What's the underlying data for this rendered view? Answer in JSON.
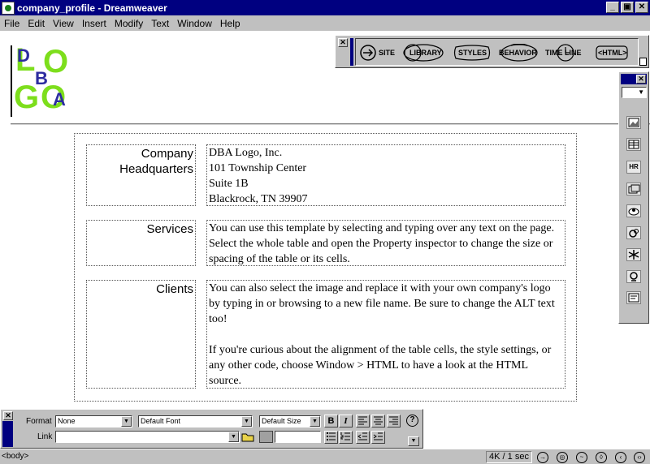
{
  "window": {
    "title": "company_profile - Dreamweaver",
    "minimize": "_",
    "restore": "▣",
    "close": "✕"
  },
  "menu": [
    "File",
    "Edit",
    "View",
    "Insert",
    "Modify",
    "Text",
    "Window",
    "Help"
  ],
  "logo": {
    "letters": [
      "L",
      "O",
      "G",
      "O"
    ],
    "overlay": [
      "D",
      "B",
      "A"
    ]
  },
  "rows": [
    {
      "label_line1": "Company",
      "label_line2": "Headquarters",
      "lines": [
        "DBA Logo, Inc.",
        "101 Township Center",
        "Suite 1B",
        "Blackrock, TN 39907"
      ]
    },
    {
      "label": "Services",
      "text": "You can use this template by selecting and typing over any text on the page. Select the whole table and open the Property inspector to change the size or spacing of the table or its cells."
    },
    {
      "label": "Clients",
      "para1": "You can also select the image and replace it with your own company's logo by typing in or browsing to a new file name. Be sure to change the ALT text too!",
      "para2": "If you're curious about the alignment of the table cells, the style settings, or any other code, choose Window > HTML to have a look at the HTML source."
    }
  ],
  "launcher": {
    "buttons": [
      "SITE",
      "LIBRARY",
      "STYLES",
      "BEHAVIOR",
      "TIME LINE",
      "<HTML>"
    ]
  },
  "objects": {
    "buttons": [
      "image-icon",
      "table-icon",
      "hr-icon",
      "layer-icon",
      "plugin-icon",
      "applet-icon",
      "activex-icon",
      "java-icon",
      "form-icon"
    ],
    "hr_label": "HR"
  },
  "properties": {
    "format_label": "Format",
    "format_value": "None",
    "font_value": "Default Font",
    "size_value": "Default Size",
    "link_label": "Link",
    "link_value": "",
    "bold": "B",
    "italic": "I",
    "help": "?"
  },
  "status": {
    "tag": "<body>",
    "size": "4K / 1 sec"
  }
}
